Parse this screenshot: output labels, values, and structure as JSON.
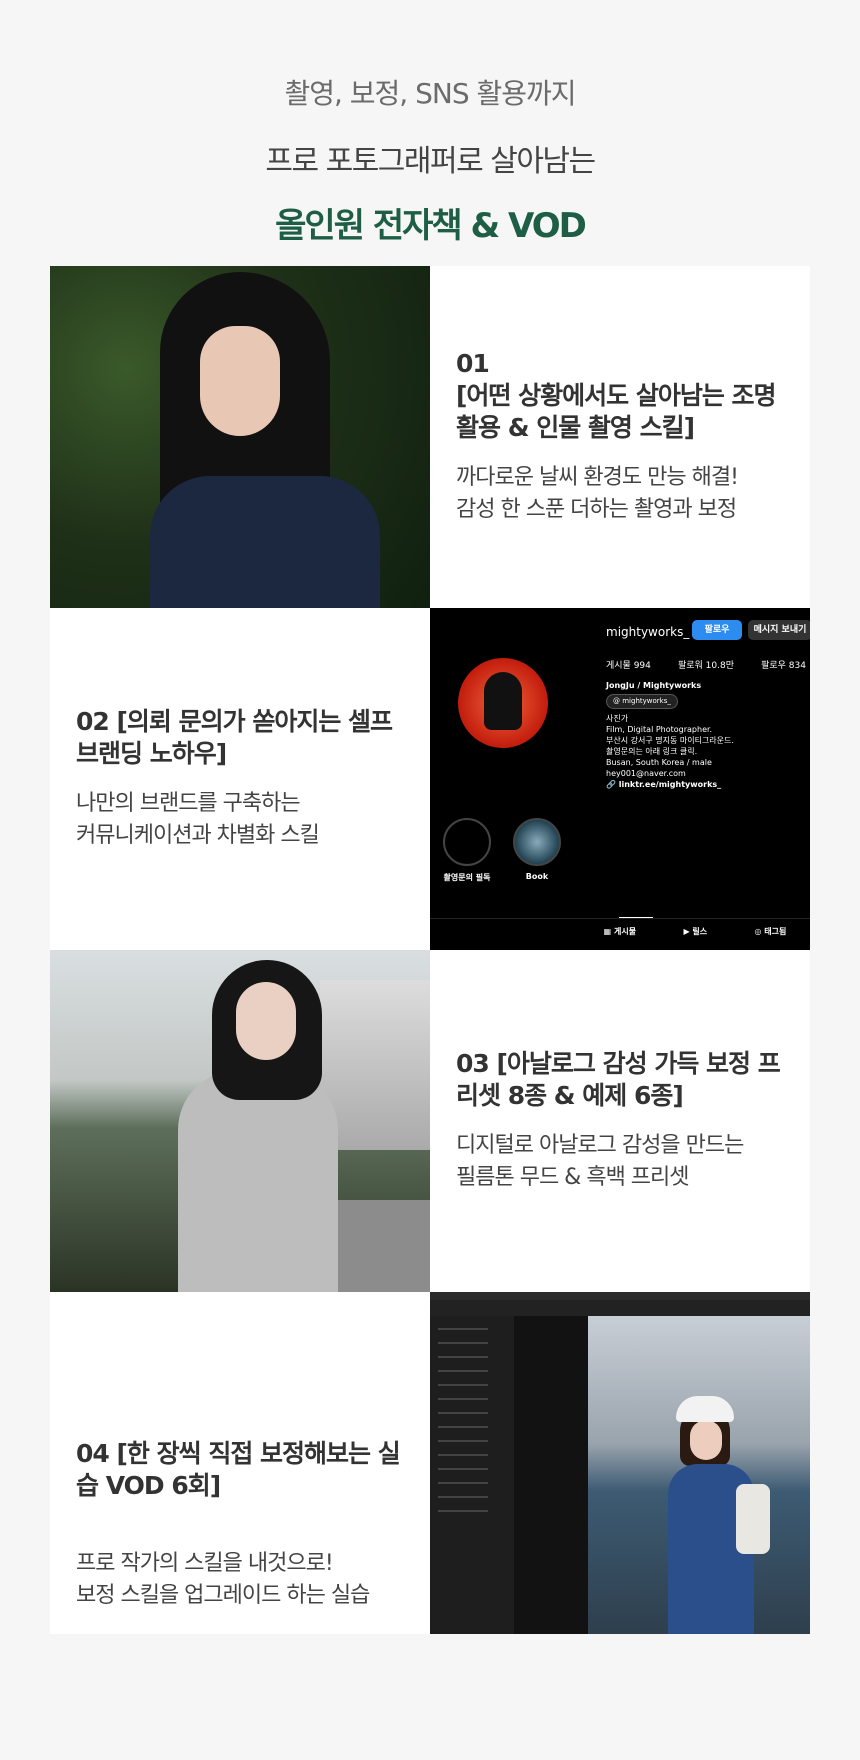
{
  "hero": {
    "line1": "촬영, 보정, SNS 활용까지",
    "line2": "프로 포토그래퍼로 살아남는",
    "line3": "올인원 전자책 & VOD"
  },
  "sections": [
    {
      "num": "01",
      "title": "[어떤 상황에서도 살아남는 조명 활용 & 인물 촬영 스킬]",
      "desc_l1": "까다로운 날씨 환경도 만능 해결!",
      "desc_l2": "감성 한 스푼 더하는 촬영과 보정"
    },
    {
      "title": "02 [의뢰 문의가 쏟아지는 셀프 브랜딩 노하우]",
      "desc_l1": "나만의 브랜드를 구축하는",
      "desc_l2": "커뮤니케이션과 차별화 스킬"
    },
    {
      "title": "03 [아날로그 감성 가득 보정 프리셋 8종 & 예제 6종]",
      "desc_l1": "디지털로 아날로그 감성을 만드는",
      "desc_l2": "필름톤 무드 & 흑백 프리셋"
    },
    {
      "title": "04 [한 장씩 직접 보정해보는 실습 VOD 6회]",
      "desc_l1": "프로 작가의 스킬을 내것으로!",
      "desc_l2": "보정 스킬을 업그레이드 하는 실습"
    }
  ],
  "instagram": {
    "username": "mightyworks_",
    "follow": "팔로우",
    "message": "메시지 보내기",
    "posts": "게시물 994",
    "followers": "팔로워 10.8만",
    "following": "팔로우 834",
    "name": "JongJu / Mightyworks",
    "handle": "mightyworks_",
    "bio_role": "사진가",
    "bio_lines": [
      "Film, Digital Photographer.",
      "부산시 강서구 명지동 마이티그라운드.",
      "촬영문의는 아래 링크 클릭.",
      "Busan, South Korea / male",
      "hey001@naver.com"
    ],
    "link": "linktr.ee/mightyworks_",
    "highlight1": "촬영문의 필독",
    "highlight2": "Book",
    "tab_posts": "게시물",
    "tab_reels": "릴스",
    "tab_tagged": "태그됨"
  },
  "colors": {
    "accent": "#1e5e45",
    "instagram_blue": "#2d8cf0"
  }
}
